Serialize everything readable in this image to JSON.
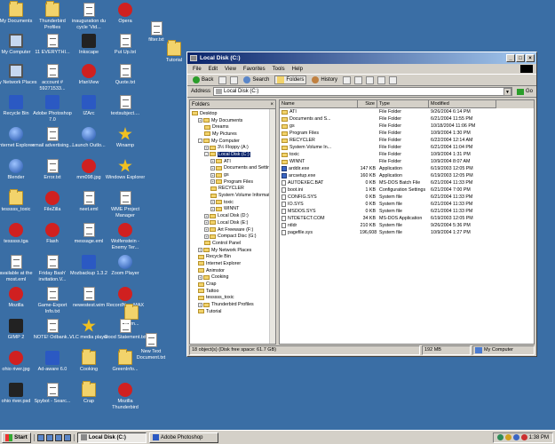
{
  "desktop": {
    "icons": [
      {
        "label": "My Documents",
        "icon": "folder"
      },
      {
        "label": "Thunderbird Profiles",
        "icon": "folder"
      },
      {
        "label": "inauguration du cycle 'Vid...",
        "icon": "doc"
      },
      {
        "label": "Opera",
        "icon": "red"
      },
      {
        "label": "My Computer",
        "icon": "monitor"
      },
      {
        "label": "11 EVERYTHI...",
        "icon": "doc"
      },
      {
        "label": "Inkscape",
        "icon": "blk"
      },
      {
        "label": "Put Up.txt",
        "icon": "doc"
      },
      {
        "label": "My Network Places",
        "icon": "monitor"
      },
      {
        "label": "account # 59271533...",
        "icon": "doc"
      },
      {
        "label": "IrfanView",
        "icon": "red"
      },
      {
        "label": "Quote.txt",
        "icon": "doc"
      },
      {
        "label": "Recycle Bin",
        "icon": "app"
      },
      {
        "label": "Adobe Photoshop 7.0",
        "icon": "app"
      },
      {
        "label": "IZArc",
        "icon": "app"
      },
      {
        "label": "textsubject....",
        "icon": "doc"
      },
      {
        "label": "Internet Explorer",
        "icon": "orb"
      },
      {
        "label": "email advertising...",
        "icon": "doc"
      },
      {
        "label": "Launch Outlo...",
        "icon": "orb"
      },
      {
        "label": "Winamp",
        "icon": "star"
      },
      {
        "label": "Blender",
        "icon": "orb"
      },
      {
        "label": "Error.txt",
        "icon": "doc"
      },
      {
        "label": "mm098.jpg",
        "icon": "red"
      },
      {
        "label": "Windows Explorer",
        "icon": "star"
      },
      {
        "label": "tesssss_toxic",
        "icon": "folder"
      },
      {
        "label": "FileZilla",
        "icon": "red"
      },
      {
        "label": "neet.eml",
        "icon": "doc"
      },
      {
        "label": "WME Project Manager",
        "icon": "doc"
      },
      {
        "label": "tesssss.tga",
        "icon": "red"
      },
      {
        "label": "Flash",
        "icon": "red"
      },
      {
        "label": "message.eml",
        "icon": "doc"
      },
      {
        "label": "Wolfenstein - Enemy Ter...",
        "icon": "red"
      },
      {
        "label": "available at the most.eml",
        "icon": "doc"
      },
      {
        "label": "Friday Bash' invitation.V...",
        "icon": "doc"
      },
      {
        "label": "Mozbackup 1.3.2",
        "icon": "app"
      },
      {
        "label": "Zoom Player",
        "icon": "orb"
      },
      {
        "label": "Mozilla",
        "icon": "red"
      },
      {
        "label": "Game-Export Info.txt",
        "icon": "doc"
      },
      {
        "label": "newestest.wim",
        "icon": "doc"
      },
      {
        "label": "RecordNow MAX",
        "icon": "red"
      },
      {
        "label": "GIMP 2",
        "icon": "blk"
      },
      {
        "label": "NOTE! Odbank...",
        "icon": "doc"
      },
      {
        "label": "VLC media player",
        "icon": "star"
      },
      {
        "label": "Good Statement.txt",
        "icon": "doc"
      },
      {
        "label": "ohio river.jpg",
        "icon": "red"
      },
      {
        "label": "Ad-aware 6.0",
        "icon": "app"
      },
      {
        "label": "Cooking",
        "icon": "folder"
      },
      {
        "label": "GreenInfo...",
        "icon": "folder"
      },
      {
        "label": "ohio river.psd",
        "icon": "blk"
      },
      {
        "label": "Spybot - Searc...",
        "icon": "doc"
      },
      {
        "label": "Crap",
        "icon": "folder"
      },
      {
        "label": "Mozilla Thunderbird",
        "icon": "red"
      },
      {
        "label": "filter.txt",
        "icon": "doc"
      },
      {
        "label": "Tutorial",
        "icon": "folder"
      },
      {
        "label": "Anim...",
        "icon": "folder"
      },
      {
        "label": "New Text Document.txt",
        "icon": "doc"
      }
    ]
  },
  "window": {
    "title": "Local Disk (C:)",
    "menu": [
      "File",
      "Edit",
      "View",
      "Favorites",
      "Tools",
      "Help"
    ],
    "toolbar": {
      "back": "Back",
      "search": "Search",
      "folders": "Folders",
      "history": "History"
    },
    "address_label": "Address",
    "address_value": "Local Disk (C:)",
    "go_label": "Go",
    "folders_title": "Folders",
    "tree": [
      {
        "label": "Desktop",
        "depth": 0
      },
      {
        "label": "My Documents",
        "depth": 1,
        "pl": "+"
      },
      {
        "label": "Dreams",
        "depth": 2
      },
      {
        "label": "My Pictures",
        "depth": 2
      },
      {
        "label": "My Computer",
        "depth": 1,
        "pl": "-"
      },
      {
        "label": "3½ Floppy (A:)",
        "depth": 2,
        "pl": "+"
      },
      {
        "label": "Local Disk (C:)",
        "depth": 2,
        "pl": "-",
        "sel": true
      },
      {
        "label": "ATI",
        "depth": 3,
        "pl": "+"
      },
      {
        "label": "Documents and Settings",
        "depth": 3,
        "pl": "+"
      },
      {
        "label": "gs",
        "depth": 3,
        "pl": "+"
      },
      {
        "label": "Program Files",
        "depth": 3,
        "pl": "+"
      },
      {
        "label": "RECYCLER",
        "depth": 3
      },
      {
        "label": "System Volume Informati",
        "depth": 3
      },
      {
        "label": "toxic",
        "depth": 3,
        "pl": "+"
      },
      {
        "label": "WINNT",
        "depth": 3,
        "pl": "+"
      },
      {
        "label": "Local Disk (D:)",
        "depth": 2,
        "pl": "+"
      },
      {
        "label": "Local Disk (E:)",
        "depth": 2,
        "pl": "+"
      },
      {
        "label": "Art Freeware (F:)",
        "depth": 2,
        "pl": "+"
      },
      {
        "label": "Compact Disc (G:)",
        "depth": 2,
        "pl": "+"
      },
      {
        "label": "Control Panel",
        "depth": 2
      },
      {
        "label": "My Network Places",
        "depth": 1,
        "pl": "+"
      },
      {
        "label": "Recycle Bin",
        "depth": 1
      },
      {
        "label": "Internet Explorer",
        "depth": 1
      },
      {
        "label": "Animstor",
        "depth": 1
      },
      {
        "label": "Cooking",
        "depth": 1,
        "pl": "+"
      },
      {
        "label": "Crap",
        "depth": 1
      },
      {
        "label": "Tattoo",
        "depth": 1
      },
      {
        "label": "tesssss_toxic",
        "depth": 1
      },
      {
        "label": "Thunderbird Profiles",
        "depth": 1,
        "pl": "+"
      },
      {
        "label": "Tutorial",
        "depth": 1
      }
    ],
    "columns": {
      "name": "Name",
      "size": "Size",
      "type": "Type",
      "modified": "Modified"
    },
    "files": [
      {
        "name": "ATI",
        "size": "",
        "type": "File Folder",
        "modified": "9/26/2004 6:14 PM",
        "icon": "folder"
      },
      {
        "name": "Documents and S...",
        "size": "",
        "type": "File Folder",
        "modified": "6/21/2004 11:55 PM",
        "icon": "folder"
      },
      {
        "name": "gs",
        "size": "",
        "type": "File Folder",
        "modified": "10/18/2004 11:06 PM",
        "icon": "folder"
      },
      {
        "name": "Program Files",
        "size": "",
        "type": "File Folder",
        "modified": "10/9/2004 1:30 PM",
        "icon": "folder"
      },
      {
        "name": "RECYCLER",
        "size": "",
        "type": "File Folder",
        "modified": "6/22/2004 12:14 AM",
        "icon": "folder"
      },
      {
        "name": "System Volume In...",
        "size": "",
        "type": "File Folder",
        "modified": "6/21/2004 11:04 PM",
        "icon": "folder"
      },
      {
        "name": "toxic",
        "size": "",
        "type": "File Folder",
        "modified": "10/9/2004 1:31 PM",
        "icon": "folder"
      },
      {
        "name": "WINNT",
        "size": "",
        "type": "File Folder",
        "modified": "10/9/2004 8:07 AM",
        "icon": "folder"
      },
      {
        "name": "arddir.exe",
        "size": "147 KB",
        "type": "Application",
        "modified": "6/19/2003 12:05 PM",
        "icon": "exe"
      },
      {
        "name": "arcsetup.exe",
        "size": "160 KB",
        "type": "Application",
        "modified": "6/19/2003 12:05 PM",
        "icon": "exe"
      },
      {
        "name": "AUTOEXEC.BAT",
        "size": "0 KB",
        "type": "MS-DOS Batch File",
        "modified": "6/21/2004 11:33 PM",
        "icon": "file"
      },
      {
        "name": "boot.ini",
        "size": "1 KB",
        "type": "Configuration Settings",
        "modified": "6/21/2004 7:00 PM",
        "icon": "file"
      },
      {
        "name": "CONFIG.SYS",
        "size": "0 KB",
        "type": "System file",
        "modified": "6/21/2004 11:33 PM",
        "icon": "file"
      },
      {
        "name": "IO.SYS",
        "size": "0 KB",
        "type": "System file",
        "modified": "6/21/2004 11:33 PM",
        "icon": "file"
      },
      {
        "name": "MSDOS.SYS",
        "size": "0 KB",
        "type": "System file",
        "modified": "6/21/2004 11:33 PM",
        "icon": "file"
      },
      {
        "name": "NTDETECT.COM",
        "size": "34 KB",
        "type": "MS-DOS Application",
        "modified": "6/19/2003 12:05 PM",
        "icon": "file"
      },
      {
        "name": "ntldr",
        "size": "210 KB",
        "type": "System file",
        "modified": "9/26/2004 5:36 PM",
        "icon": "file"
      },
      {
        "name": "pagefile.sys",
        "size": "196,608 KB",
        "type": "System file",
        "modified": "10/9/2004 1:27 PM",
        "icon": "file"
      }
    ],
    "status": {
      "objects": "18 object(s) (Disk free space: 61.7 GB)",
      "size": "192 MB",
      "location": "My Computer"
    }
  },
  "taskbar": {
    "start": "Start",
    "tasks": [
      {
        "label": "Local Disk (C:)",
        "active": true
      },
      {
        "label": "Adobe Photoshop",
        "active": false
      }
    ],
    "clock": "1:38 PM"
  }
}
